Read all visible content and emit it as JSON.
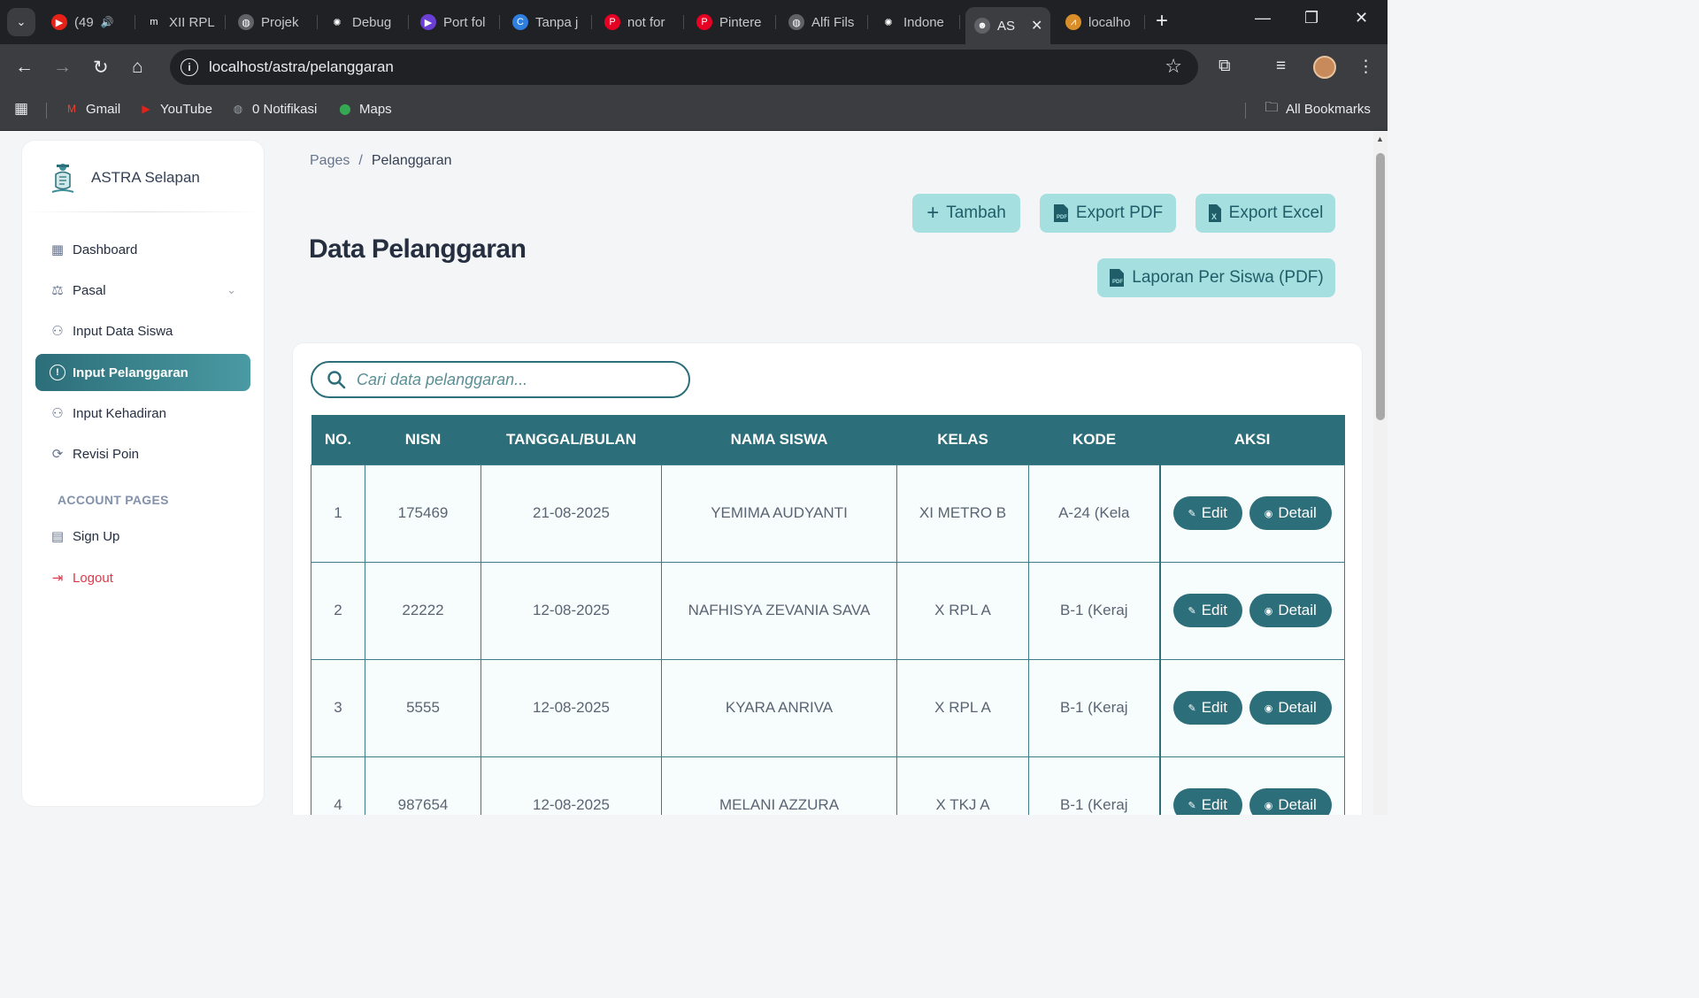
{
  "browser": {
    "tabs": [
      {
        "label": "(49",
        "color": "#e62117",
        "glyph": "▶"
      },
      {
        "label": "XII RPL",
        "color": "#202124",
        "glyph": "m"
      },
      {
        "label": "Projek",
        "color": "#5f6368",
        "glyph": "◍"
      },
      {
        "label": "Debug",
        "color": "#202124",
        "glyph": "✺"
      },
      {
        "label": "Port fol",
        "color": "#6b3fd6",
        "glyph": "▶"
      },
      {
        "label": "Tanpa j",
        "color": "#2f7fe0",
        "glyph": "C"
      },
      {
        "label": "not for",
        "color": "#e60023",
        "glyph": "P"
      },
      {
        "label": "Pintere",
        "color": "#e60023",
        "glyph": "P"
      },
      {
        "label": "Alfi Fils",
        "color": "#5f6368",
        "glyph": "◍"
      },
      {
        "label": "Indone",
        "color": "#202124",
        "glyph": "✺"
      },
      {
        "label": "AS",
        "color": "#5f6368",
        "glyph": "☻"
      },
      {
        "label": "localho",
        "color": "#d98e2a",
        "glyph": "⩘"
      }
    ],
    "url": "localhost/astra/pelanggaran",
    "bookmarks": [
      {
        "label": "Gmail",
        "glyph": "M",
        "color": "#ea4335"
      },
      {
        "label": "YouTube",
        "glyph": "▶",
        "color": "#e62117"
      },
      {
        "label": "0 Notifikasi",
        "glyph": "◍",
        "color": "#9aa0a6"
      },
      {
        "label": "Maps",
        "glyph": "⬤",
        "color": "#34a853"
      }
    ],
    "all_bookmarks": "All Bookmarks"
  },
  "sidebar": {
    "brand": "ASTRA Selapan",
    "items": [
      {
        "label": "Dashboard",
        "icon": "grid-icon",
        "glyph": "▦"
      },
      {
        "label": "Pasal",
        "icon": "gavel-icon",
        "glyph": "⚖"
      },
      {
        "label": "Input Data Siswa",
        "icon": "user-plus-icon",
        "glyph": "⚇"
      },
      {
        "label": "Input Pelanggaran",
        "icon": "alert-circle-icon",
        "glyph": "!"
      },
      {
        "label": "Input Kehadiran",
        "icon": "user-check-icon",
        "glyph": "⚇"
      },
      {
        "label": "Revisi Poin",
        "icon": "refresh-icon",
        "glyph": "⟳"
      }
    ],
    "account_title": "ACCOUNT PAGES",
    "account_items": [
      {
        "label": "Sign Up",
        "icon": "clipboard-icon",
        "glyph": "▤"
      },
      {
        "label": "Logout",
        "icon": "logout-icon",
        "glyph": "⇥"
      }
    ]
  },
  "breadcrumb": {
    "root": "Pages",
    "separator": "/",
    "current": "Pelanggaran"
  },
  "title": "Data Pelanggaran",
  "actions": {
    "tambah": "Tambah",
    "export_pdf": "Export PDF",
    "export_excel": "Export Excel",
    "laporan": "Laporan Per Siswa (PDF)"
  },
  "search": {
    "placeholder": "Cari data pelanggaran..."
  },
  "table": {
    "columns": [
      "NO.",
      "NISN",
      "TANGGAL/BULAN",
      "NAMA SISWA",
      "KELAS",
      "KODE",
      "AKSI"
    ],
    "rows": [
      [
        "1",
        "175469",
        "21-08-2025",
        "YEMIMA AUDYANTI",
        "XI METRO B",
        "A-24 (Kela"
      ],
      [
        "2",
        "22222",
        "12-08-2025",
        "NAFHISYA ZEVANIA SAVA",
        "X RPL A",
        "B-1 (Keraj"
      ],
      [
        "3",
        "5555",
        "12-08-2025",
        "KYARA ANRIVA",
        "X RPL A",
        "B-1 (Keraj"
      ],
      [
        "4",
        "987654",
        "12-08-2025",
        "MELANI AZZURA",
        "X TKJ A",
        "B-1 (Keraj"
      ]
    ],
    "edit_label": "Edit",
    "detail_label": "Detail"
  },
  "colors": {
    "primary": "#2c6e79",
    "button_light": "#a6dfe0",
    "logout": "#e0384a"
  }
}
